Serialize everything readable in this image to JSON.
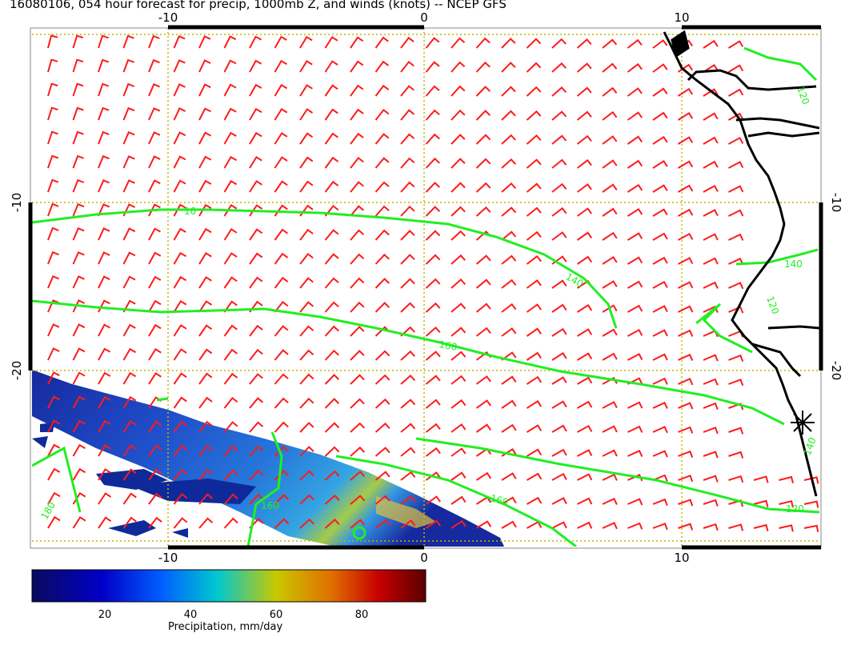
{
  "title": "16080106, 054 hour forecast for precip, 1000mb Z, and winds (knots) -- NCEP GFS",
  "map": {
    "lon_range": [
      -15.5,
      15.5
    ],
    "lat_range": [
      -30.5,
      0.5
    ],
    "top_ticks": [
      "-10",
      "0",
      "10"
    ],
    "bottom_ticks": [
      "-10",
      "0",
      "10"
    ],
    "left_ticks": [
      "-10",
      "-20"
    ],
    "right_ticks": [
      "-10",
      "-20"
    ],
    "contour_labels": [
      "120",
      "10",
      "140",
      "140",
      "120",
      "160",
      "160",
      "180",
      "140",
      "120",
      "160"
    ],
    "colors": {
      "wind_barb": "#ff1a1a",
      "contour": "#22ee22",
      "grid": "#c8b400",
      "coast": "#000000"
    }
  },
  "colorbar": {
    "ticks": [
      "20",
      "40",
      "60",
      "80"
    ],
    "label": "Precipitation, mm/day",
    "range": [
      4,
      96
    ],
    "colors": [
      "#0a0a60",
      "#0000c8",
      "#005fff",
      "#00c8d0",
      "#c8c800",
      "#e07000",
      "#c80000",
      "#5a0000"
    ]
  }
}
